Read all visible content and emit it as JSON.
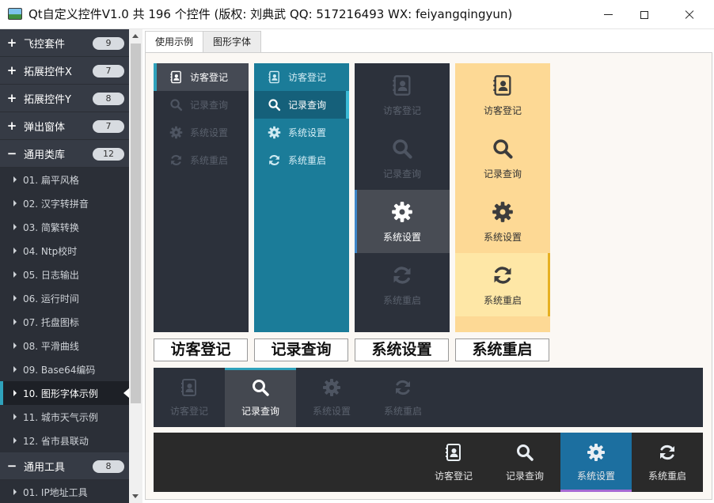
{
  "window": {
    "title": "Qt自定义控件V1.0 共 196 个控件 (版权: 刘典武 QQ: 517216493 WX: feiyangqingyun)"
  },
  "nav": {
    "parents": [
      {
        "label": "飞控套件",
        "count": "9",
        "sign": "+"
      },
      {
        "label": "拓展控件X",
        "count": "7",
        "sign": "+"
      },
      {
        "label": "拓展控件Y",
        "count": "8",
        "sign": "+"
      },
      {
        "label": "弹出窗体",
        "count": "7",
        "sign": "+"
      },
      {
        "label": "通用类库",
        "count": "12",
        "sign": "−"
      }
    ],
    "children": [
      "01. 扁平风格",
      "02. 汉字转拼音",
      "03. 简繁转换",
      "04. Ntp校时",
      "05. 日志输出",
      "06. 运行时间",
      "07. 托盘图标",
      "08. 平滑曲线",
      "09. Base64编码",
      "10. 图形字体示例",
      "11. 城市天气示例",
      "12. 省市县联动"
    ],
    "selected_child": 9,
    "tools": {
      "label": "通用工具",
      "count": "8",
      "sign": "−"
    },
    "tools_children": [
      "01. IP地址工具"
    ]
  },
  "tabs": [
    "使用示例",
    "图形字体"
  ],
  "active_tab": 0,
  "buttons": [
    "访客登记",
    "记录查询",
    "系统设置",
    "系统重启"
  ],
  "icons": [
    "address-book-icon",
    "search-icon",
    "gear-icon",
    "refresh-icon"
  ],
  "colors": {
    "dark": "#2c313b",
    "teal": "#1b7c99",
    "teal_accent": "#3bbad6",
    "amber": "#fdd995",
    "amber_active": "#fee7a6",
    "amber_accent": "#e6b022",
    "bar_selected": "#1c6fa0"
  }
}
